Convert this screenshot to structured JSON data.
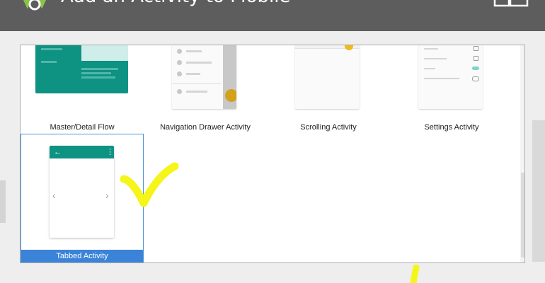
{
  "window": {
    "title": "Add an Activity to Mobile"
  },
  "templates": [
    {
      "label": "Master/Detail Flow",
      "icon": "master-detail-preview"
    },
    {
      "label": "Navigation Drawer Activity",
      "icon": "navigation-drawer-preview"
    },
    {
      "label": "Scrolling Activity",
      "icon": "scrolling-preview"
    },
    {
      "label": "Settings Activity",
      "icon": "settings-preview"
    },
    {
      "label": "Tabbed Activity",
      "icon": "tabbed-preview",
      "selected": true
    }
  ],
  "tabbed_preview": {
    "back_glyph": "←",
    "menu_glyph": "⋮",
    "left_glyph": "‹",
    "right_glyph": "›"
  },
  "colors": {
    "accent": "#0e9282",
    "selection": "#3a83d8",
    "annotation": "#f5f51a",
    "fab": "#d4a21a"
  }
}
